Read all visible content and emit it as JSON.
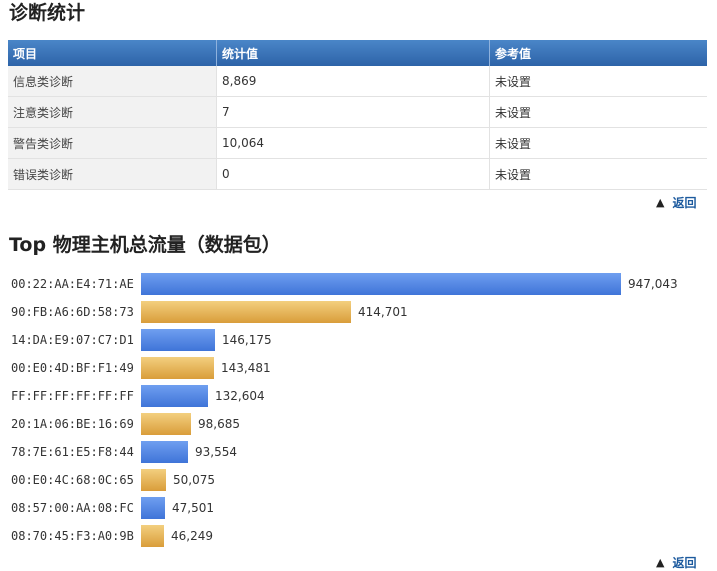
{
  "stats_section": {
    "title": "诊断统计",
    "headers": [
      "项目",
      "统计值",
      "参考值"
    ],
    "rows": [
      {
        "item": "信息类诊断",
        "value": "8,869",
        "ref": "未设置"
      },
      {
        "item": "注意类诊断",
        "value": "7",
        "ref": "未设置"
      },
      {
        "item": "警告类诊断",
        "value": "10,064",
        "ref": "未设置"
      },
      {
        "item": "错误类诊断",
        "value": "0",
        "ref": "未设置"
      }
    ],
    "back_label": "返回"
  },
  "top_section": {
    "title": "Top 物理主机总流量（数据包）",
    "back_label": "返回"
  },
  "colors": {
    "header_blue": "#2d63a8",
    "bar_blue": "#3f74d8",
    "bar_gold": "#d99d3a",
    "link": "#1c5a9e"
  },
  "chart_data": {
    "type": "bar",
    "orientation": "horizontal",
    "title": "Top 物理主机总流量（数据包）",
    "categories": [
      "00:22:AA:E4:71:AE",
      "90:FB:A6:6D:58:73",
      "14:DA:E9:07:C7:D1",
      "00:E0:4D:BF:F1:49",
      "FF:FF:FF:FF:FF:FF",
      "20:1A:06:BE:16:69",
      "78:7E:61:E5:F8:44",
      "00:E0:4C:68:0C:65",
      "08:57:00:AA:08:FC",
      "08:70:45:F3:A0:9B"
    ],
    "values": [
      947043,
      414701,
      146175,
      143481,
      132604,
      98685,
      93554,
      50075,
      47501,
      46249
    ],
    "value_labels": [
      "947,043",
      "414,701",
      "146,175",
      "143,481",
      "132,604",
      "98,685",
      "93,554",
      "50,075",
      "47,501",
      "46,249"
    ],
    "bar_colors": [
      "blue",
      "gold",
      "blue",
      "gold",
      "blue",
      "gold",
      "blue",
      "gold",
      "blue",
      "gold"
    ]
  }
}
